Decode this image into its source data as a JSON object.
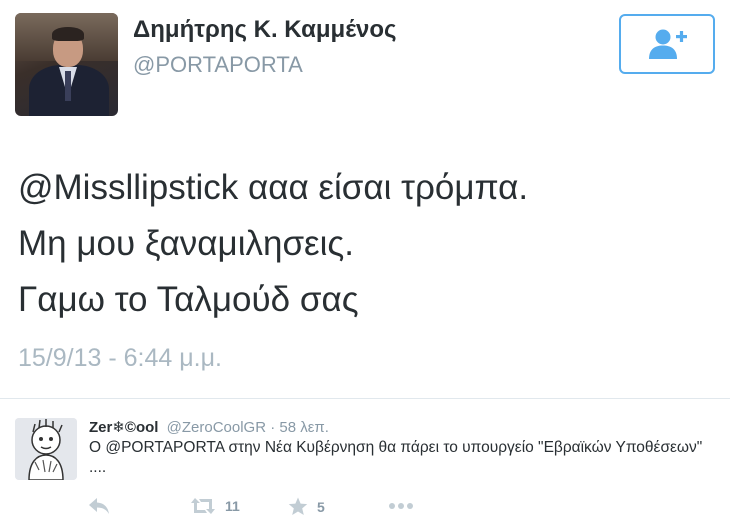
{
  "tweet": {
    "display_name": "Δημήτρης Κ. Καμμένος",
    "screen_name": "@PORTAPORTA",
    "text_lines": [
      "@Missllipstick ααα είσαι τρόμπα.",
      "Μη μου ξαναμιλησεις.",
      "Γαμω το Ταλμούδ σας"
    ],
    "timestamp": "15/9/13 - 6:44 μ.μ.",
    "follow_icon": "add-user-icon"
  },
  "reply": {
    "display_name": "Zer❄©ool",
    "handle": "@ZeroCoolGR",
    "time": " · 58 λεπ.",
    "text": "Ο @PORTAPORTA στην Νέα Κυβέρνηση θα πάρει το υπουργείο \"Εβραϊκών Υποθέσεων\" ....",
    "retweet_count": "11",
    "favorite_count": "5"
  },
  "colors": {
    "accent": "#55acee",
    "muted": "#8899a6",
    "timestamp": "#aab8c2",
    "icon": "#c2cdd4"
  }
}
